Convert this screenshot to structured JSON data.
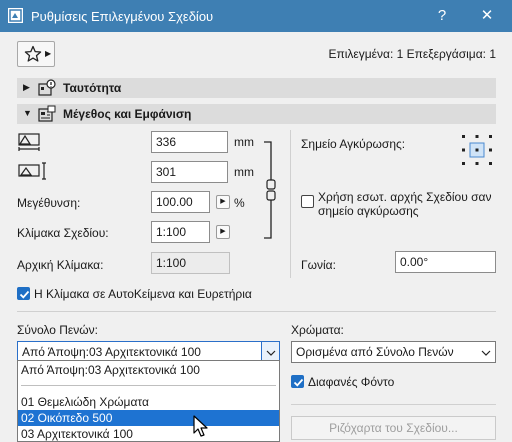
{
  "window": {
    "title": "Ρυθμίσεις Επιλεγμένου Σχεδίου",
    "help_label": "?",
    "close_label": "✕"
  },
  "toolbar": {
    "selection_status": "Επιλεγμένα: 1 Επεξεργάσιμα: 1"
  },
  "sections": {
    "identity": {
      "label": "Ταυτότητα"
    },
    "size_appearance": {
      "label": "Μέγεθος και Εμφάνιση"
    }
  },
  "size": {
    "width_value": "336",
    "width_unit": "mm",
    "height_value": "301",
    "height_unit": "mm",
    "magnification_label": "Μεγέθυνση:",
    "magnification_value": "100.00",
    "magnification_unit": "%",
    "drawing_scale_label": "Κλίμακα Σχεδίου:",
    "drawing_scale_value": "1:100",
    "original_scale_label": "Αρχική Κλίμακα:",
    "original_scale_value": "1:100"
  },
  "anchor": {
    "label": "Σημείο Αγκύρωσης:",
    "use_origin_label": "Χρήση εσωτ. αρχής Σχεδίου σαν σημείο αγκύρωσης",
    "use_origin_checked": false,
    "angle_label": "Γωνία:",
    "angle_value": "0.00°"
  },
  "autotext": {
    "label": "Η Κλίμακα σε ΑυτοΚείμενα και Ευρετήρια",
    "checked": true
  },
  "pens": {
    "pen_set_label": "Σύνολο Πενών:",
    "pen_set_value": "Από Άποψη:03 Αρχιτεκτονικά 100",
    "options": [
      "Από Άποψη:03 Αρχιτεκτονικά 100",
      "01 Θεμελιώδη Χρώματα",
      "02 Οικόπεδο 500",
      "03 Αρχιτεκτονικά 100"
    ],
    "highlighted_option": "02 Οικόπεδο 500",
    "colors_label": "Χρώματα:",
    "colors_value": "Ορισμένα από Σύνολο Πενών",
    "transparent_bg_label": "Διαφανές Φόντο",
    "transparent_bg_checked": true,
    "drawing_plot_button": "Ριζόχαρτα του Σχεδίου..."
  },
  "colors": {
    "titlebar": "#3e7fb3",
    "highlight": "#1e73d2",
    "checkbox": "#1f6fc5"
  }
}
